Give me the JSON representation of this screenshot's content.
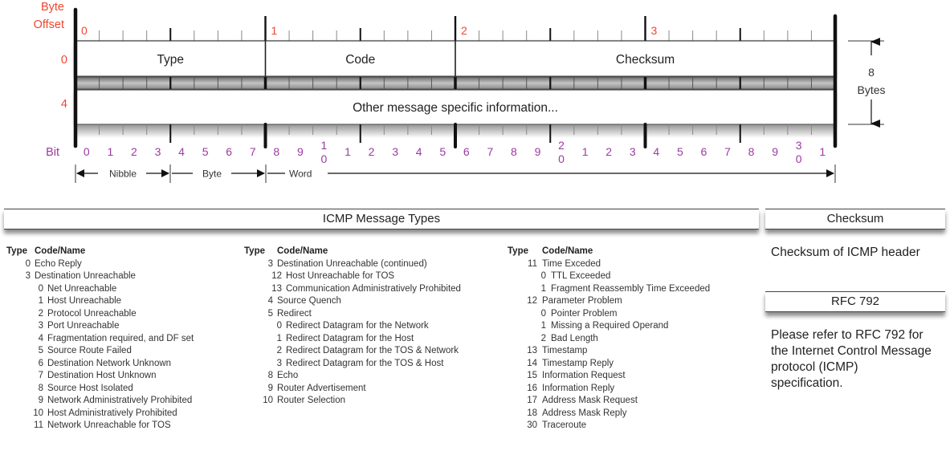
{
  "header_diagram": {
    "byte_offset_label": [
      "Byte",
      "Offset"
    ],
    "byte_markers": [
      "0",
      "1",
      "2",
      "3"
    ],
    "row_offsets": [
      "0",
      "4"
    ],
    "fields_row0": [
      {
        "label": "Type",
        "bits": 8
      },
      {
        "label": "Code",
        "bits": 8
      },
      {
        "label": "Checksum",
        "bits": 16
      }
    ],
    "field_row1": "Other message specific information...",
    "bit_label": "Bit",
    "bit_numbers": [
      "0",
      "1",
      "2",
      "3",
      "4",
      "5",
      "6",
      "7",
      "8",
      "9",
      "1|0",
      "1",
      "2",
      "3",
      "4",
      "5",
      "6",
      "7",
      "8",
      "9",
      "2|0",
      "1",
      "2",
      "3",
      "4",
      "5",
      "6",
      "7",
      "8",
      "9",
      "3|0",
      "1"
    ],
    "size_annotation": [
      "8",
      "Bytes"
    ],
    "span_labels": {
      "nibble": "Nibble",
      "byte": "Byte",
      "word": "Word"
    },
    "colors": {
      "byte_offset": "#f0452f",
      "bit": "#9b3aa0",
      "line": "#111111"
    }
  },
  "message_types": {
    "title": "ICMP Message Types",
    "col_headers": {
      "type": "Type",
      "code": "Code/Name"
    },
    "columns": [
      [
        {
          "type": "0",
          "name": "Echo Reply"
        },
        {
          "type": "3",
          "name": "Destination Unreachable"
        },
        {
          "code": "0",
          "name": "Net Unreachable"
        },
        {
          "code": "1",
          "name": "Host Unreachable"
        },
        {
          "code": "2",
          "name": "Protocol Unreachable"
        },
        {
          "code": "3",
          "name": "Port Unreachable"
        },
        {
          "code": "4",
          "name": "Fragmentation required, and DF set"
        },
        {
          "code": "5",
          "name": "Source Route Failed"
        },
        {
          "code": "6",
          "name": "Destination Network Unknown"
        },
        {
          "code": "7",
          "name": "Destination Host Unknown"
        },
        {
          "code": "8",
          "name": "Source Host Isolated"
        },
        {
          "code": "9",
          "name": "Network Administratively Prohibited"
        },
        {
          "code": "10",
          "name": "Host Administratively Prohibited"
        },
        {
          "code": "11",
          "name": "Network Unreachable for TOS"
        }
      ],
      [
        {
          "type": "3",
          "name": "Destination Unreachable (continued)"
        },
        {
          "code": "12",
          "name": "Host Unreachable for TOS"
        },
        {
          "code": "13",
          "name": "Communication Administratively Prohibited"
        },
        {
          "type": "4",
          "name": "Source Quench"
        },
        {
          "type": "5",
          "name": "Redirect"
        },
        {
          "code": "0",
          "name": "Redirect Datagram for the Network"
        },
        {
          "code": "1",
          "name": "Redirect Datagram for the Host"
        },
        {
          "code": "2",
          "name": "Redirect Datagram for the TOS & Network"
        },
        {
          "code": "3",
          "name": "Redirect Datagram for the TOS & Host"
        },
        {
          "type": "8",
          "name": "Echo"
        },
        {
          "type": "9",
          "name": "Router Advertisement"
        },
        {
          "type": "10",
          "name": "Router Selection"
        }
      ],
      [
        {
          "type": "11",
          "name": "Time Exceded"
        },
        {
          "code": "0",
          "name": "TTL Exceeded"
        },
        {
          "code": "1",
          "name": "Fragment Reassembly Time Exceeded"
        },
        {
          "type": "12",
          "name": "Parameter Problem"
        },
        {
          "code": "0",
          "name": "Pointer Problem"
        },
        {
          "code": "1",
          "name": "Missing a Required Operand"
        },
        {
          "code": "2",
          "name": "Bad Length"
        },
        {
          "type": "13",
          "name": "Timestamp"
        },
        {
          "type": "14",
          "name": "Timestamp Reply"
        },
        {
          "type": "15",
          "name": "Information Request"
        },
        {
          "type": "16",
          "name": "Information Reply"
        },
        {
          "type": "17",
          "name": "Address Mask Request"
        },
        {
          "type": "18",
          "name": "Address Mask Reply"
        },
        {
          "type": "30",
          "name": "Traceroute"
        }
      ]
    ]
  },
  "checksum_panel": {
    "title": "Checksum",
    "text": "Checksum of ICMP header"
  },
  "rfc_panel": {
    "title": "RFC 792",
    "text": "Please refer to RFC 792 for the Internet Control Message protocol (ICMP) specification."
  }
}
